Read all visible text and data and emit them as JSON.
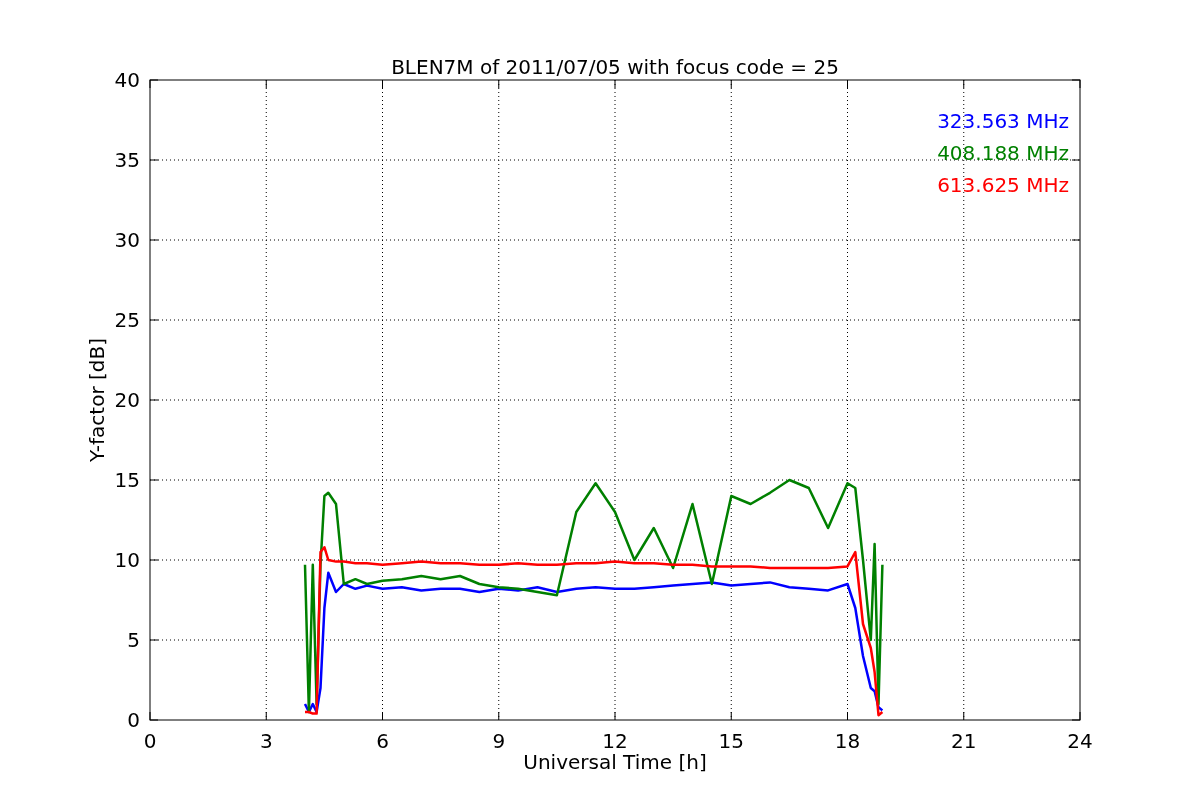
{
  "chart_data": {
    "type": "line",
    "title": "BLEN7M of 2011/07/05 with focus code = 25",
    "xlabel": "Universal Time [h]",
    "ylabel": "Y-factor [dB]",
    "x": [
      4.0,
      4.1,
      4.2,
      4.3,
      4.4,
      4.5,
      4.6,
      4.8,
      5.0,
      5.3,
      5.6,
      6.0,
      6.5,
      7.0,
      7.5,
      8.0,
      8.5,
      9.0,
      9.5,
      10.0,
      10.5,
      11.0,
      11.5,
      12.0,
      12.5,
      13.0,
      13.5,
      14.0,
      14.5,
      15.0,
      15.5,
      16.0,
      16.5,
      17.0,
      17.5,
      18.0,
      18.2,
      18.4,
      18.6,
      18.7,
      18.8,
      18.9
    ],
    "series": [
      {
        "name": "323.563 MHz",
        "color": "#0000ff",
        "values": [
          1,
          0.5,
          1.0,
          0.5,
          2,
          7,
          9.2,
          8,
          8.5,
          8.2,
          8.4,
          8.2,
          8.3,
          8.1,
          8.2,
          8.2,
          8.0,
          8.2,
          8.1,
          8.3,
          8.0,
          8.2,
          8.3,
          8.2,
          8.2,
          8.3,
          8.4,
          8.5,
          8.6,
          8.4,
          8.5,
          8.6,
          8.3,
          8.2,
          8.1,
          8.5,
          7,
          4,
          2,
          1.8,
          0.8,
          0.6
        ]
      },
      {
        "name": "408.188 MHz",
        "color": "#008000",
        "values": [
          9.7,
          0.5,
          9.7,
          1,
          9.7,
          14,
          14.2,
          13.5,
          8.5,
          8.8,
          8.5,
          8.7,
          8.8,
          9,
          8.8,
          9,
          8.5,
          8.3,
          8.2,
          8.0,
          7.8,
          13,
          14.8,
          13,
          10,
          12,
          9.5,
          13.5,
          8.5,
          14,
          13.5,
          14.2,
          15,
          14.5,
          12,
          14.8,
          14.5,
          10,
          5,
          11,
          1,
          9.7
        ]
      },
      {
        "name": "613.625 MHz",
        "color": "#ff0000",
        "values": [
          0.5,
          0.5,
          0.4,
          0.4,
          10.5,
          10.8,
          10,
          9.9,
          9.9,
          9.8,
          9.8,
          9.7,
          9.8,
          9.9,
          9.8,
          9.8,
          9.7,
          9.7,
          9.8,
          9.7,
          9.7,
          9.8,
          9.8,
          9.9,
          9.8,
          9.8,
          9.7,
          9.7,
          9.6,
          9.6,
          9.6,
          9.5,
          9.5,
          9.5,
          9.5,
          9.6,
          10.5,
          6,
          4.5,
          3,
          0.3,
          0.5
        ]
      }
    ],
    "grid": true,
    "xlim": [
      0,
      24
    ],
    "ylim": [
      0,
      40
    ],
    "xticks": [
      0,
      3,
      6,
      9,
      12,
      15,
      18,
      21,
      24
    ],
    "yticks": [
      0,
      5,
      10,
      15,
      20,
      25,
      30,
      35,
      40
    ]
  }
}
